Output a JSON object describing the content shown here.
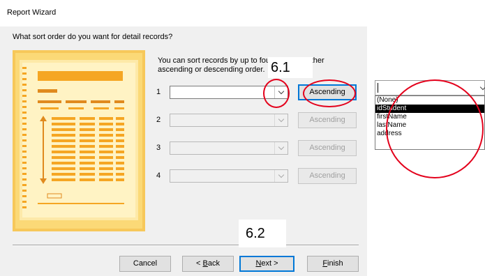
{
  "window": {
    "title": "Report Wizard"
  },
  "question": "What sort order do you want for detail records?",
  "hint": [
    "You can sort records by up to four fields, in either",
    "ascending or descending order."
  ],
  "sort_rows": [
    {
      "num": "1",
      "value": "",
      "button": "Ascending",
      "enabled": true
    },
    {
      "num": "2",
      "value": "",
      "button": "Ascending",
      "enabled": false
    },
    {
      "num": "3",
      "value": "",
      "button": "Ascending",
      "enabled": false
    },
    {
      "num": "4",
      "value": "",
      "button": "Ascending",
      "enabled": false
    }
  ],
  "footer": {
    "cancel": "Cancel",
    "back_prefix": "< ",
    "back_accel": "B",
    "back_rest": "ack",
    "next_accel": "N",
    "next_rest": "ext >",
    "finish_accel": "F",
    "finish_rest": "inish"
  },
  "annotations": {
    "step1": "6.1",
    "step2": "6.2",
    "color": "#e3001b"
  },
  "dropdown_popup": {
    "value": "",
    "options": [
      "(None)",
      "idStudent",
      "firstName",
      "lastName",
      "address"
    ],
    "selected_index": 1
  },
  "icons": [
    "chevron-down-icon",
    "report-layout-illustration"
  ],
  "colors": {
    "window_bg": "#f0f0f0",
    "default_button_border": "#0078d7",
    "annotation_red": "#e3001b",
    "illustration_orange": "#f5a623"
  }
}
